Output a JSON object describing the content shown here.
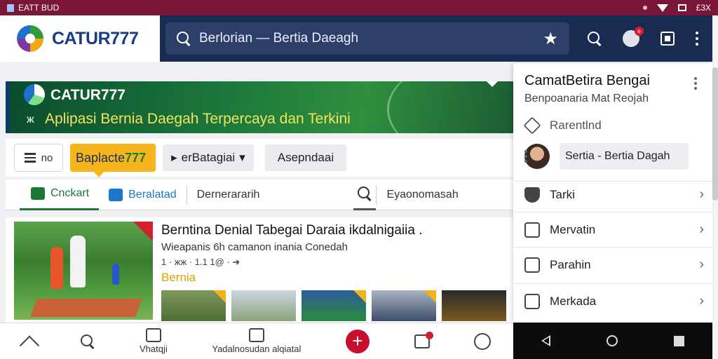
{
  "status": {
    "app": "EATT BUD",
    "right": "£3X"
  },
  "header": {
    "brand": "CATUR777",
    "search_text": "Berlorian — Bertia Daeagh",
    "avatar_badge": "e"
  },
  "banner": {
    "name": "CATUR777",
    "tagline": "Aplipasi Bernia Daegah Terpercaya dan Terkini",
    "mark": "ж"
  },
  "toolbar": {
    "menu_label": "no",
    "category_text": "Baplacte",
    "category_num": "777",
    "select_label": "erBatagiai",
    "select_caret": "▸",
    "select_arrow": "▾",
    "plain_label": "Asepndaai"
  },
  "tabs": [
    {
      "label": "Cnckart"
    },
    {
      "label": "Beralatad"
    },
    {
      "label": "Dernerararih"
    },
    {
      "label": "Eyaonomasah"
    }
  ],
  "article": {
    "title": "Berntina Denial Tabegai Daraia ikdalnigaiia .",
    "subtitle": "Wieapanis 6h camanon inania Conedah",
    "meta": "1 ·  жж · 1.1 1@ ·  ➜",
    "category": "Bernia"
  },
  "bottom_nav": {
    "item2_label": "Vhatqji",
    "item3_label": "Yadalnosudan alqiatal",
    "fab": "+"
  },
  "panel": {
    "title": "CamatBetira Bengai",
    "subtitle": "Benpoanaria Mat Reojah",
    "recent_label": "Rarentlnd",
    "chip_label": "Sertia - Bertia Dagah",
    "items": [
      {
        "label": "Tarki"
      },
      {
        "label": "Mervatin"
      },
      {
        "label": "Parahin"
      },
      {
        "label": "Merkada"
      }
    ]
  },
  "colors": {
    "statusbar": "#7a1638",
    "appbar": "#1a2b52",
    "accent_green": "#1a7a34",
    "accent_yellow": "#f6b51b",
    "fab_red": "#c8102e"
  }
}
